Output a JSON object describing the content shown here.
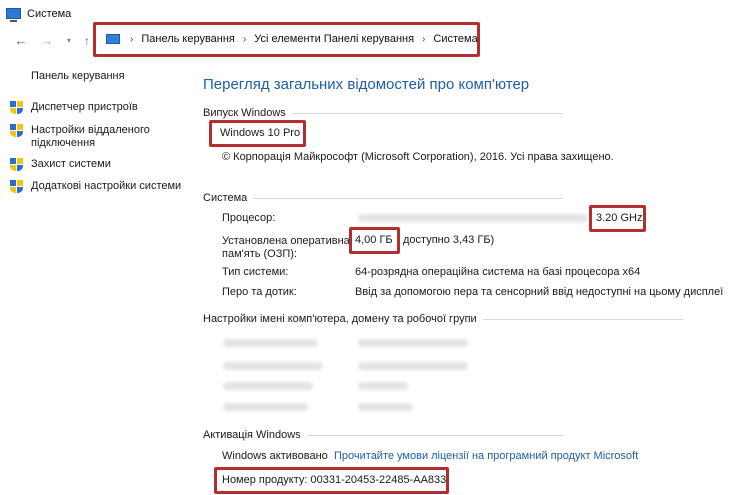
{
  "window": {
    "title": "Система"
  },
  "nav": {
    "back_icon": "arrow-left-icon",
    "forward_icon": "arrow-right-icon",
    "up_icon": "arrow-up-icon",
    "breadcrumbs": [
      "Панель керування",
      "Усі елементи Панелі керування",
      "Система"
    ]
  },
  "sidebar": {
    "home": "Панель керування",
    "items": [
      {
        "label": "Диспетчер пристроїв",
        "icon": "shield-icon"
      },
      {
        "label": "Настройки віддаленого підключення",
        "icon": "shield-icon"
      },
      {
        "label": "Захист системи",
        "icon": "shield-icon"
      },
      {
        "label": "Додаткові настройки системи",
        "icon": "shield-icon"
      }
    ]
  },
  "main": {
    "title": "Перегляд загальних відомостей про комп'ютер",
    "edition": {
      "heading": "Випуск Windows",
      "name": "Windows 10 Pro",
      "copyright": "© Корпорація Майкрософт (Microsoft Corporation), 2016. Усі права захищено."
    },
    "system": {
      "heading": "Система",
      "processor_label": "Процесор:",
      "processor_speed": "3.20 GHz",
      "ram_label_1": "Установлена оперативна",
      "ram_label_2": "пам'ять (ОЗП):",
      "ram_value": "4,00 ГБ",
      "ram_usable": "доступно 3,43 ГБ)",
      "type_label": "Тип системи:",
      "type_value": "64-розрядна операційна система на базі процесора x64",
      "pen_label": "Перо та дотик:",
      "pen_value": "Ввід за допомогою пера та сенсорний ввід недоступні на цьому дисплеї"
    },
    "computer_name": {
      "heading": "Настройки імені комп'ютера, домену та робочої групи"
    },
    "activation": {
      "heading": "Активація Windows",
      "status": "Windows активовано",
      "license_link": "Прочитайте умови ліцензії на програмний продукт Microsoft",
      "product_id": "Номер продукту: 00331-20453-22485-AA833"
    }
  },
  "colors": {
    "highlight": "#b32f2f",
    "link": "#1f5fa8"
  }
}
